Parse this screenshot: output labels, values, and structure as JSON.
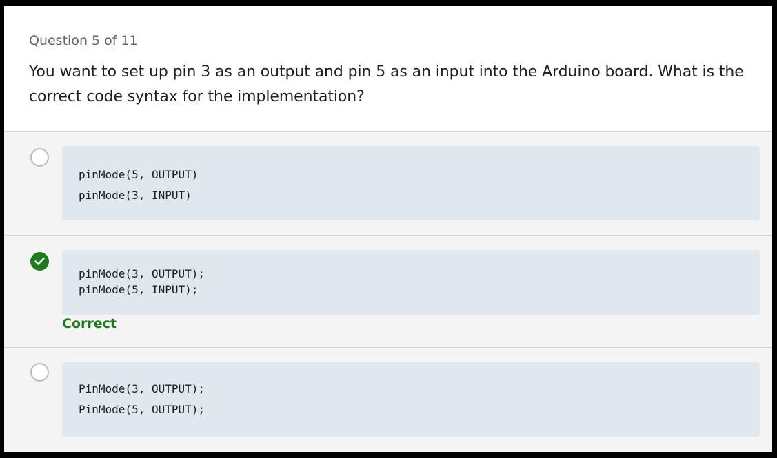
{
  "question": {
    "counter": "Question 5 of 11",
    "text": "You want to set up pin 3 as an output and pin 5 as an input into the Arduino board. What is the correct code syntax for the implementation?"
  },
  "options": [
    {
      "selected": false,
      "code_lines": [
        "pinMode(5, OUTPUT)",
        "pinMode(3, INPUT)"
      ]
    },
    {
      "selected": true,
      "code_lines": [
        "pinMode(3, OUTPUT);",
        "pinMode(5, INPUT);"
      ],
      "feedback": "Correct"
    },
    {
      "selected": false,
      "code_lines": [
        "PinMode(3, OUTPUT);",
        "PinMode(5, OUTPUT);"
      ]
    }
  ],
  "icons": {
    "correct": "checkmark-icon"
  },
  "colors": {
    "correct_green": "#1f7a1f",
    "code_background": "#e1e7ee",
    "page_background": "#f4f4f4"
  }
}
